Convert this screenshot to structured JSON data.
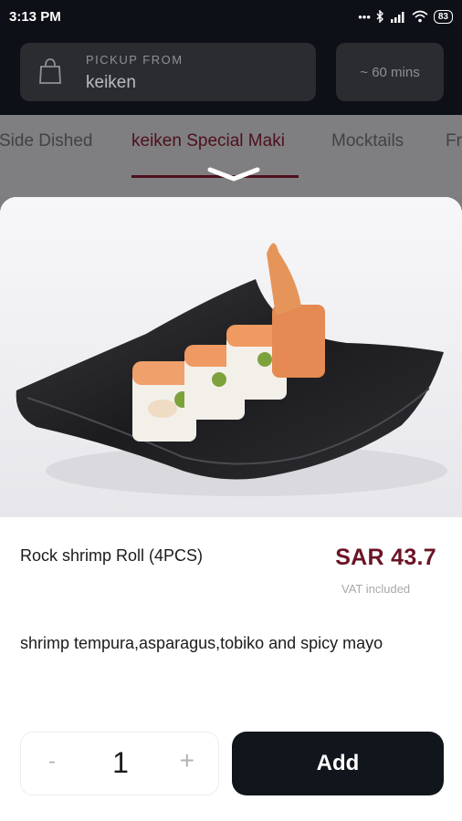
{
  "status_bar": {
    "time": "3:13 PM",
    "battery": "83",
    "icons": [
      "dots-icon",
      "bluetooth-icon",
      "signal-icon",
      "wifi-icon",
      "battery-icon"
    ]
  },
  "header": {
    "pickup_label": "PICKUP FROM",
    "pickup_value": "keiken",
    "eta": "~ 60 mins"
  },
  "tabs": [
    {
      "label": "Side Dished"
    },
    {
      "label": "keiken Special Maki",
      "active": true
    },
    {
      "label": "Mocktails"
    },
    {
      "label": "Fr"
    }
  ],
  "item": {
    "name": "Rock shrimp Roll (4PCS)",
    "price": "SAR 43.7",
    "vat_note": "VAT included",
    "description": "shrimp tempura,asparagus,tobiko and spicy mayo"
  },
  "quantity": {
    "minus": "-",
    "value": "1",
    "plus": "+"
  },
  "add_label": "Add",
  "colors": {
    "brand": "#6b1425",
    "dark": "#11151c",
    "overlay": "#7f7f81"
  }
}
